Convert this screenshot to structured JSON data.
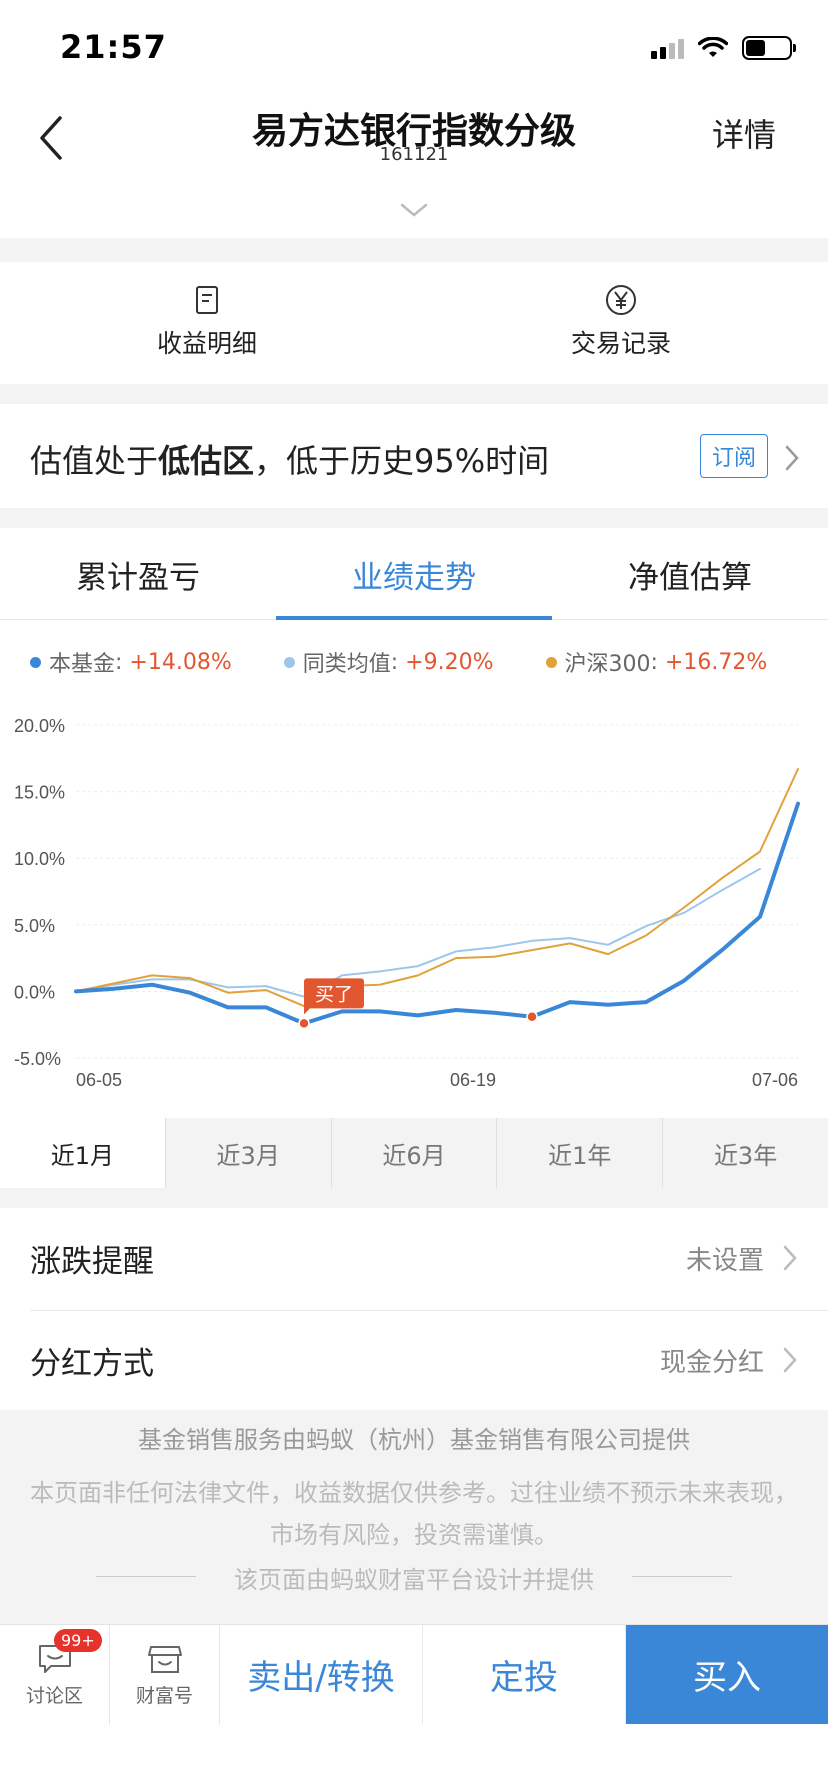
{
  "status": {
    "time": "21:57"
  },
  "nav": {
    "title": "易方达银行指数分级",
    "code": "161121",
    "detail": "详情"
  },
  "quick": [
    {
      "label": "收益明细",
      "icon": "document-icon"
    },
    {
      "label": "交易记录",
      "icon": "yen-circle-icon"
    }
  ],
  "valuation": {
    "prefix": "估值处于",
    "zone": "低估区",
    "suffix": "，低于历史95%时间",
    "subscribe": "订阅"
  },
  "tabs": [
    {
      "label": "累计盈亏",
      "active": false
    },
    {
      "label": "业绩走势",
      "active": true
    },
    {
      "label": "净值估算",
      "active": false
    }
  ],
  "legend": [
    {
      "name": "本基金",
      "value": "+14.08%",
      "color": "#3a87d8"
    },
    {
      "name": "同类均值",
      "value": "+9.20%",
      "color": "#9cc6ec"
    },
    {
      "name": "沪深300",
      "value": "+16.72%",
      "color": "#e0a23a"
    }
  ],
  "chart_data": {
    "type": "line",
    "ylim": [
      -5,
      20
    ],
    "y_ticks": [
      "20.0%",
      "15.0%",
      "10.0%",
      "5.0%",
      "0.0%",
      "-5.0%"
    ],
    "x_ticks": [
      "06-05",
      "06-19",
      "07-06"
    ],
    "series": [
      {
        "name": "本基金",
        "color": "#3a87d8",
        "values": [
          0.0,
          0.2,
          0.5,
          -0.1,
          -1.2,
          -1.2,
          -2.4,
          -1.5,
          -1.5,
          -1.8,
          -1.4,
          -1.6,
          -1.9,
          -0.8,
          -1.0,
          -0.8,
          0.8,
          3.1,
          5.6,
          14.1
        ]
      },
      {
        "name": "同类均值",
        "color": "#9cc6ec",
        "values": [
          0.0,
          0.5,
          0.9,
          0.9,
          0.3,
          0.4,
          -0.4,
          1.2,
          1.5,
          1.9,
          3.0,
          3.3,
          3.8,
          4.0,
          3.5,
          4.9,
          5.9,
          7.6,
          9.2,
          null
        ]
      },
      {
        "name": "沪深300",
        "color": "#e0a23a",
        "values": [
          0.0,
          0.6,
          1.2,
          1.0,
          -0.1,
          0.1,
          -1.1,
          0.4,
          0.5,
          1.2,
          2.5,
          2.6,
          3.1,
          3.6,
          2.8,
          4.2,
          6.3,
          8.5,
          10.5,
          16.7
        ]
      }
    ],
    "markers": [
      {
        "index": 6,
        "label": "买了"
      },
      {
        "index": 12,
        "label": ""
      }
    ]
  },
  "ranges": [
    {
      "label": "近1月",
      "active": true
    },
    {
      "label": "近3月",
      "active": false
    },
    {
      "label": "近6月",
      "active": false
    },
    {
      "label": "近1年",
      "active": false
    },
    {
      "label": "近3年",
      "active": false
    }
  ],
  "settings": [
    {
      "label": "涨跌提醒",
      "value": "未设置"
    },
    {
      "label": "分红方式",
      "value": "现金分红"
    }
  ],
  "footer": {
    "line1": "基金销售服务由蚂蚁（杭州）基金销售有限公司提供",
    "line2": "本页面非任何法律文件，收益数据仅供参考。过往业绩不预示未来表现，市场有风险，投资需谨慎。",
    "line3": "该页面由蚂蚁财富平台设计并提供"
  },
  "bottom": {
    "discuss": "讨论区",
    "badge": "99+",
    "wealth": "财富号",
    "sell": "卖出/转换",
    "fixed": "定投",
    "buy": "买入"
  }
}
